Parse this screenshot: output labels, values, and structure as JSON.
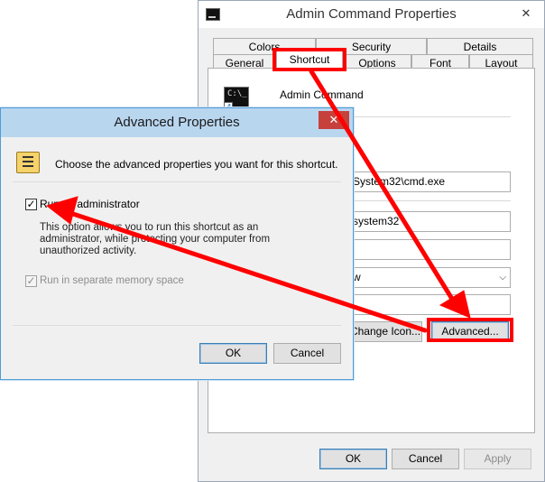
{
  "main_window": {
    "title": "Admin Command Properties",
    "close_glyph": "✕",
    "tabs_row1": [
      "Colors",
      "Security",
      "Details"
    ],
    "tabs_row2": [
      "General",
      "Shortcut",
      "Options",
      "Font",
      "Layout"
    ],
    "active_tab": "Shortcut",
    "shortcut_name": "Admin Command",
    "shortcut_icon_glyph": "C:\\_",
    "target_value": "System32\\cmd.exe",
    "start_in_value": "system32",
    "shortcut_key_value": "",
    "run_value": "w",
    "comment_value": "",
    "change_icon_label": "Change Icon...",
    "advanced_label": "Advanced...",
    "ok_label": "OK",
    "cancel_label": "Cancel",
    "apply_label": "Apply"
  },
  "advanced_dialog": {
    "title": "Advanced Properties",
    "close_glyph": "✕",
    "intro": "Choose the advanced properties you want for this shortcut.",
    "run_as_admin_label": "Run as administrator",
    "run_as_admin_checked": true,
    "check_glyph": "✓",
    "run_as_admin_desc": "This option allows you to run this shortcut as an administrator, while protecting your computer from unauthorized activity.",
    "separate_memory_label": "Run in separate memory space",
    "ok_label": "OK",
    "cancel_label": "Cancel"
  },
  "icons": [
    "cmd-app-icon",
    "shortcut-overlay-icon",
    "properties-document-icon",
    "close-icon",
    "dropdown-chevron-icon"
  ],
  "colors": {
    "annotation_red": "#ff0000",
    "title_active": "#b9d6ef",
    "close_red": "#c7413c",
    "window_bg": "#f0f0f0"
  }
}
